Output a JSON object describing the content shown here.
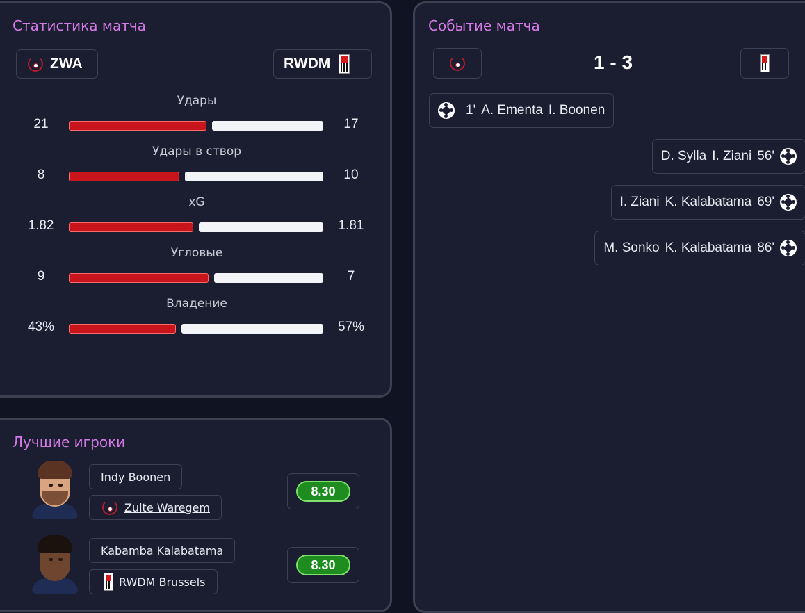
{
  "stats_panel": {
    "title": "Статистика матча",
    "home_team": "ZWA",
    "away_team": "RWDM",
    "rows": [
      {
        "label": "Удары",
        "home": "21",
        "away": "17",
        "home_share": 0.553
      },
      {
        "label": "Удары в створ",
        "home": "8",
        "away": "10",
        "home_share": 0.444
      },
      {
        "label": "xG",
        "home": "1.82",
        "away": "1.81",
        "home_share": 0.501
      },
      {
        "label": "Угловые",
        "home": "9",
        "away": "7",
        "home_share": 0.5625
      },
      {
        "label": "Владение",
        "home": "43%",
        "away": "57%",
        "home_share": 0.43
      }
    ]
  },
  "events_panel": {
    "title": "Событие матча",
    "score": "1 - 3",
    "events": [
      {
        "side": "home",
        "minute": "1'",
        "scorer": "A. Ementa",
        "assist": "I. Boonen"
      },
      {
        "side": "away",
        "minute": "56'",
        "scorer": "D. Sylla",
        "assist": "I. Ziani"
      },
      {
        "side": "away",
        "minute": "69'",
        "scorer": "I. Ziani",
        "assist": "K. Kalabatama"
      },
      {
        "side": "away",
        "minute": "86'",
        "scorer": "M. Sonko",
        "assist": "K. Kalabatama"
      }
    ]
  },
  "players_panel": {
    "title": "Лучшие игроки",
    "players": [
      {
        "name": "Indy Boonen",
        "team": "Zulte Waregem",
        "rating": "8.30"
      },
      {
        "name": "Kabamba Kalabatama",
        "team": "RWDM Brussels",
        "rating": "8.30"
      }
    ]
  },
  "colors": {
    "accent_title": "#d77ae8",
    "home_bar": "#c8141b",
    "away_bar": "#f3f4f8",
    "rating_green": "#1e8c1e"
  }
}
